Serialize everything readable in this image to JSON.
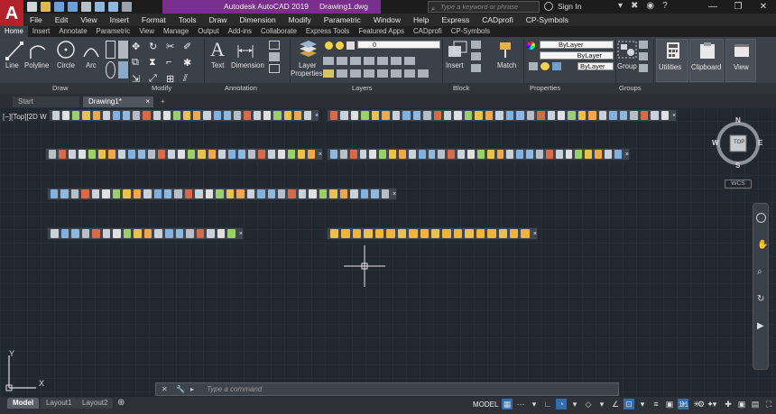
{
  "title": {
    "app_name": "Autodesk AutoCAD 2019",
    "file_name": "Drawing1.dwg",
    "search_placeholder": "Type a keyword or phrase",
    "sign_in": "Sign In"
  },
  "menu": [
    "File",
    "Edit",
    "View",
    "Insert",
    "Format",
    "Tools",
    "Draw",
    "Dimension",
    "Modify",
    "Parametric",
    "Window",
    "Help",
    "Express",
    "CADprofi",
    "CP-Symbols"
  ],
  "ribbon_tabs": [
    "Home",
    "Insert",
    "Annotate",
    "Parametric",
    "View",
    "Manage",
    "Output",
    "Add-ins",
    "Collaborate",
    "Express Tools",
    "Featured Apps",
    "CADprofi",
    "CP-Symbols"
  ],
  "ribbon": {
    "draw_tools": [
      "Line",
      "Polyline",
      "Circle",
      "Arc"
    ],
    "text": "Text",
    "dimension": "Dimension",
    "layer_properties": [
      "Layer",
      "Properties"
    ],
    "layer_value": "0",
    "insert": "Insert",
    "match": "Match",
    "properties_values": [
      "ByLayer",
      "ByLayer",
      "ByLayer"
    ],
    "group": "Group",
    "utilities": "Utilities",
    "clipboard": "Clipboard",
    "view": "View",
    "panels": [
      "Draw",
      "Modify",
      "Annotation",
      "Layers",
      "Block",
      "Properties",
      "Groups"
    ]
  },
  "doc_tabs": [
    "Start",
    "Drawing1*"
  ],
  "viewport_label": "[−][Top][2D W",
  "viewcube": {
    "top": "TOP",
    "n": "N",
    "s": "S",
    "e": "E",
    "w": "W",
    "wcs": "WCS"
  },
  "ucs": {
    "x": "X",
    "y": "Y"
  },
  "command": {
    "placeholder": "Type a command"
  },
  "layout_tabs": [
    "Model",
    "Layout1",
    "Layout2"
  ],
  "status": {
    "model": "MODEL",
    "scale": "1:1"
  }
}
